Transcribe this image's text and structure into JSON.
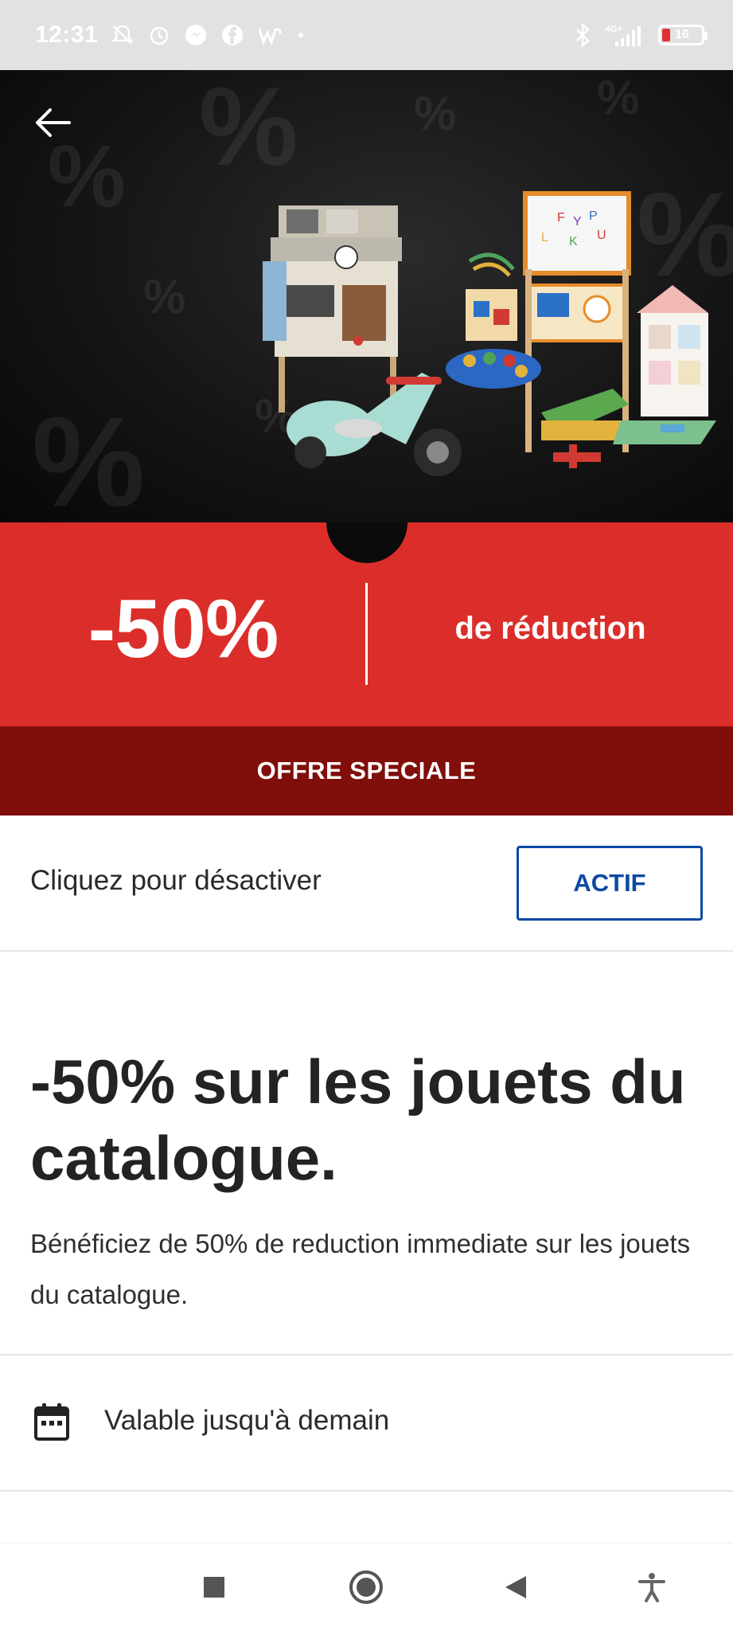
{
  "status_bar": {
    "time": "12:31",
    "battery_level": "16",
    "network": "4G+",
    "icons": [
      "silent-alarm-icon",
      "alarm-icon",
      "messenger-icon",
      "facebook-icon",
      "w-app-icon",
      "dot-icon",
      "bluetooth-icon",
      "signal-icon",
      "battery-icon"
    ]
  },
  "hero": {
    "image_description": "toys-promo-image"
  },
  "discount": {
    "value": "-50%",
    "label": "de réduction",
    "band_label": "OFFRE SPECIALE"
  },
  "toggle": {
    "label": "Cliquez pour désactiver",
    "button_label": "ACTIF"
  },
  "main": {
    "headline": "-50% sur les jouets du catalogue.",
    "description": "Bénéficiez de 50% de reduction immediate sur les jouets du catalogue."
  },
  "validity": {
    "text": "Valable jusqu'à demain"
  },
  "colors": {
    "red": "#db2e2a",
    "dark_red": "#800e0b",
    "blue": "#0b4aa2"
  }
}
